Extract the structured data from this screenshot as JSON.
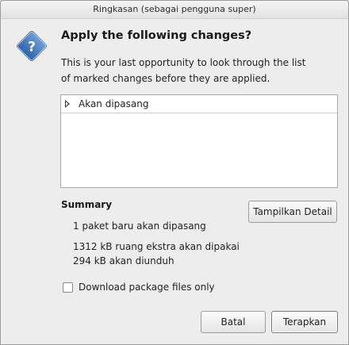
{
  "window": {
    "title": "Ringkasan (sebagai pengguna super)"
  },
  "dialog": {
    "icon": "question-icon",
    "heading": "Apply the following changes?",
    "message": "This is your last opportunity to look through the list of marked changes before they are applied."
  },
  "changes_tree": {
    "items": [
      {
        "label": "Akan dipasang",
        "expanded": false
      }
    ]
  },
  "summary": {
    "title": "Summary",
    "lines": [
      "1 paket baru akan dipasang",
      "1312 kB ruang ekstra akan dipakai",
      "294 kB akan diunduh"
    ],
    "details_button": "Tampilkan Detail"
  },
  "options": {
    "download_only_label": "Download package files only",
    "download_only_checked": false
  },
  "buttons": {
    "cancel": "Batal",
    "apply": "Terapkan"
  },
  "colors": {
    "icon_blue": "#4a7fc0"
  }
}
